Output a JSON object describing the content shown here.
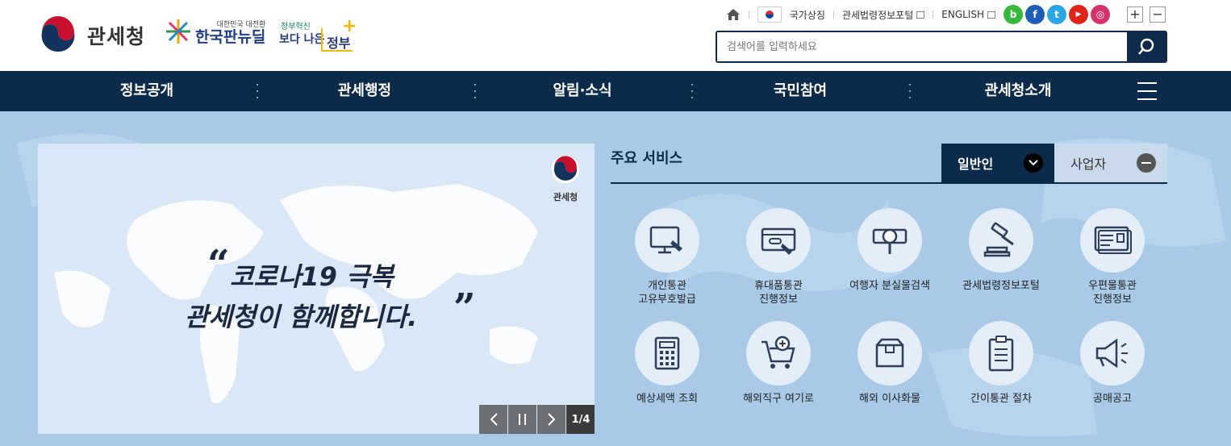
{
  "header": {
    "logo_text": "관세청",
    "newdeal_small": "대한민국 대전환",
    "newdeal_big": "한국판뉴딜",
    "gov_small": "정부혁신",
    "gov_big1": "보다 나은",
    "gov_big2": "정부",
    "gov_plus": "+",
    "utility": {
      "symbol": "국가상징",
      "law_portal": "관세법령정보포털",
      "english": "ENGLISH"
    },
    "sns": [
      {
        "name": "blog",
        "letter": "b",
        "color": "#36b93a"
      },
      {
        "name": "facebook",
        "letter": "f",
        "color": "#1e5db5"
      },
      {
        "name": "twitter",
        "letter": "t",
        "color": "#2aa5e6"
      },
      {
        "name": "youtube",
        "letter": "▶",
        "color": "#e0261a"
      },
      {
        "name": "instagram",
        "letter": "◎",
        "color": "#d6336c"
      }
    ],
    "zoom_in": "+",
    "zoom_out": "−",
    "search_placeholder": "검색어를 입력하세요"
  },
  "nav": {
    "items": [
      "정보공개",
      "관세행정",
      "알림·소식",
      "국민참여",
      "관세청소개"
    ]
  },
  "banner": {
    "quote_open": "“",
    "quote_close": "”",
    "line1": "코로나19 극복",
    "line2": "관세청이 함께합니다.",
    "logo_caption": "관세청",
    "counter": "1/4"
  },
  "services": {
    "title": "주요 서비스",
    "tab_general": "일반인",
    "tab_business": "사업자",
    "items": [
      {
        "label": "개인통관\n고유부호발급",
        "icon": "monitor-click-icon"
      },
      {
        "label": "휴대품통관\n진행정보",
        "icon": "card-device-icon"
      },
      {
        "label": "여행자 분실물검색",
        "icon": "magnifier-icon"
      },
      {
        "label": "관세법령정보포털",
        "icon": "gavel-icon"
      },
      {
        "label": "우편물통관\n진행정보",
        "icon": "mail-card-icon"
      },
      {
        "label": "예상세액 조회",
        "icon": "calculator-icon"
      },
      {
        "label": "해외직구 여기로",
        "icon": "cart-plus-icon"
      },
      {
        "label": "해외 이사화물",
        "icon": "box-icon"
      },
      {
        "label": "간이통관 절차",
        "icon": "clipboard-icon"
      },
      {
        "label": "공매공고",
        "icon": "megaphone-icon"
      }
    ]
  }
}
